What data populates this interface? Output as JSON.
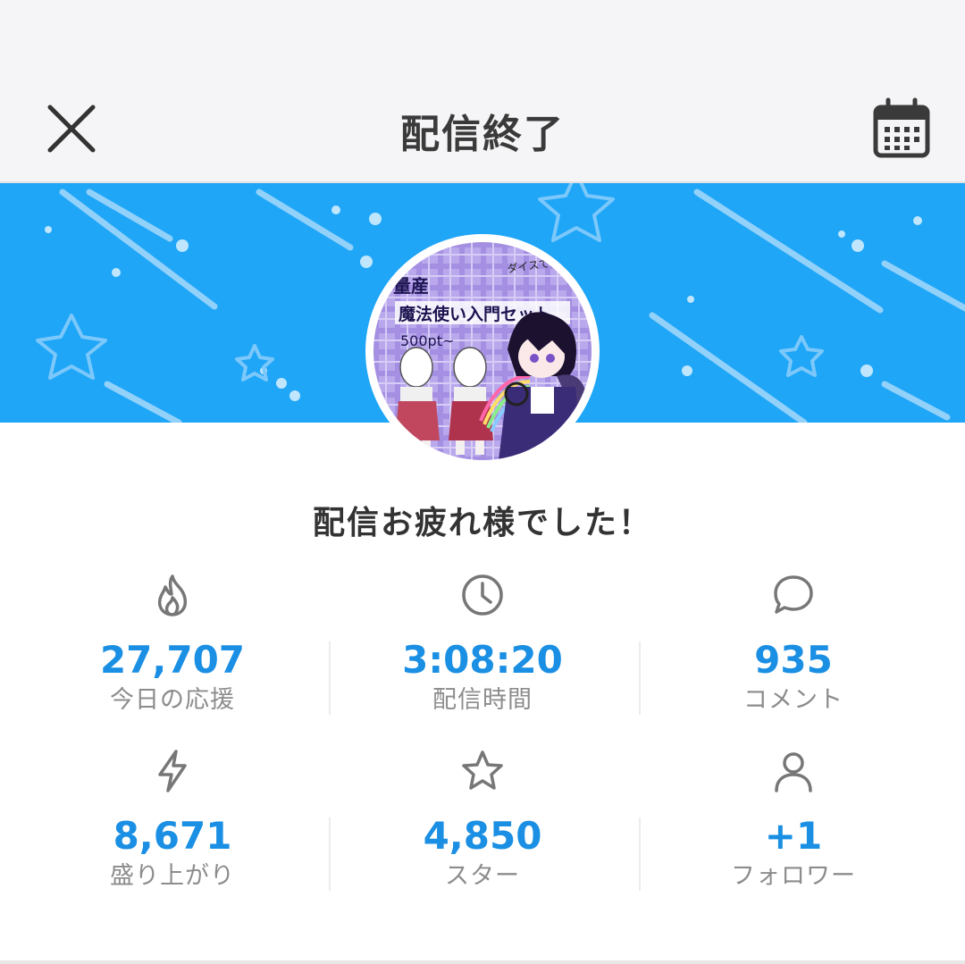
{
  "header": {
    "title": "配信終了",
    "close_icon": "close-icon",
    "calendar_icon": "calendar-icon"
  },
  "banner": {
    "background_color": "#1fa6f7",
    "avatar_text": {
      "line1": "量産",
      "line2": "魔法使い入門セット",
      "line3": "500pt~",
      "corner": "ダイスで割引"
    }
  },
  "message": "配信お疲れ様でした！",
  "stats": [
    {
      "icon": "fire-icon",
      "value": "27,707",
      "label": "今日の応援"
    },
    {
      "icon": "clock-icon",
      "value": "3:08:20",
      "label": "配信時間"
    },
    {
      "icon": "comment-icon",
      "value": "935",
      "label": "コメント"
    },
    {
      "icon": "lightning-icon",
      "value": "8,671",
      "label": "盛り上がり"
    },
    {
      "icon": "star-icon",
      "value": "4,850",
      "label": "スター"
    },
    {
      "icon": "person-icon",
      "value": "+1",
      "label": "フォロワー"
    }
  ],
  "colors": {
    "accent": "#1a8fe3",
    "label": "#8c8c8c",
    "banner": "#1fa6f7"
  }
}
